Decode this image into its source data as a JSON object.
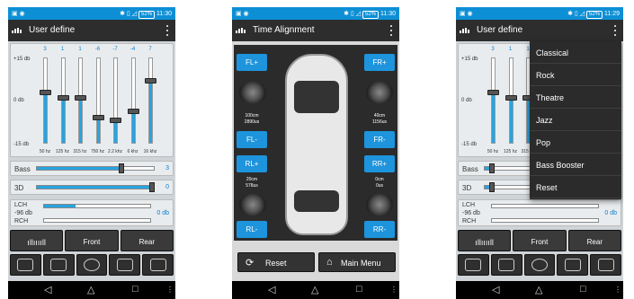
{
  "status": {
    "time1": "11:30",
    "time2": "11:30",
    "time3": "11:29",
    "battery": "52%"
  },
  "screen1": {
    "title": "User define",
    "db_top": "+15 db",
    "db_mid": "0 db",
    "db_bot": "-15 db",
    "bands": [
      {
        "value": "3",
        "freq": "50 hz",
        "level": 0.6
      },
      {
        "value": "1",
        "freq": "125 hz",
        "level": 0.53
      },
      {
        "value": "1",
        "freq": "315 hz",
        "level": 0.53
      },
      {
        "value": "-6",
        "freq": "750 hz",
        "level": 0.3
      },
      {
        "value": "-7",
        "freq": "2.2 khz",
        "level": 0.27
      },
      {
        "value": "-4",
        "freq": "6 khz",
        "level": 0.37
      },
      {
        "value": "7",
        "freq": "16 khz",
        "level": 0.73
      }
    ],
    "bass_label": "Bass",
    "bass_value": "3",
    "bass_level": 0.73,
    "threed_label": "3D",
    "threed_value": "0",
    "threed_level": 1.0,
    "lch_label": "LCH",
    "rch_label": "RCH",
    "mix_db": "-96 db",
    "mix_value": "0 db",
    "front_label": "Front",
    "rear_label": "Rear"
  },
  "screen2": {
    "title": "Time Alignment",
    "fl_plus": "FL+",
    "fl_minus": "FL-",
    "fr_plus": "FR+",
    "fr_minus": "FR-",
    "rl_plus": "RL+",
    "rl_minus": "RL-",
    "rr_plus": "RR+",
    "rr_minus": "RR-",
    "fl_dist": "100cm",
    "fl_time": "2890us",
    "fr_dist": "40cm",
    "fr_time": "1156us",
    "rl_dist": "20cm",
    "rl_time": "578us",
    "rr_dist": "0cm",
    "rr_time": "0us",
    "reset_label": "Reset",
    "main_menu_label": "Main Menu"
  },
  "screen3": {
    "title": "User define",
    "menu": [
      "Classical",
      "Rock",
      "Theatre",
      "Jazz",
      "Pop",
      "Bass Booster",
      "Reset"
    ]
  }
}
